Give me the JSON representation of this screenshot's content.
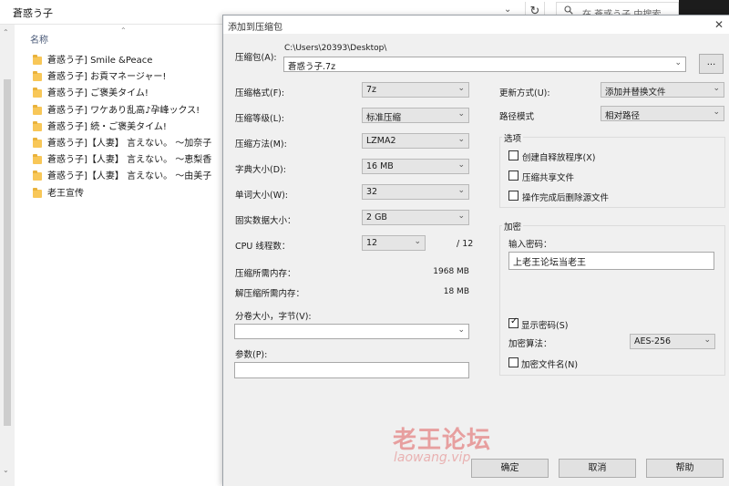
{
  "explorer": {
    "path": "蒼惑う子",
    "search_placeholder": "在 蒼惑う子 中搜索",
    "column_header": "名称",
    "files": [
      "蒼惑う子] Smile &Peace",
      "蒼惑う子] お貢マネージャー!",
      "蒼惑う子] ご褒美タイム!",
      "蒼惑う子] ワケあり乱高♪孕峰ックス!",
      "蒼惑う子] 続・ご褒美タイム!",
      "蒼惑う子]【人妻】 言えない。 ～加奈子",
      "蒼惑う子]【人妻】 言えない。 ～恵梨香",
      "蒼惑う子]【人妻】 言えない。 ～由美子",
      "老王宣传"
    ]
  },
  "dialog": {
    "title": "添加到压缩包",
    "archive_label": "压缩包(A):",
    "archive_dir": "C:\\Users\\20393\\Desktop\\",
    "archive_name": "蒼惑う子.7z",
    "browse_label": "...",
    "format_label": "压缩格式(F):",
    "format_value": "7z",
    "level_label": "压缩等级(L):",
    "level_value": "标准压缩",
    "method_label": "压缩方法(M):",
    "method_value": "LZMA2",
    "dict_label": "字典大小(D):",
    "dict_value": "16 MB",
    "word_label": "单词大小(W):",
    "word_value": "32",
    "solid_label": "固实数据大小：",
    "solid_value": "2 GB",
    "threads_label": "CPU 线程数：",
    "threads_value": "12",
    "threads_total": "/ 12",
    "mem_compress_label": "压缩所需内存：",
    "mem_compress_value": "1968 MB",
    "mem_decompress_label": "解压缩所需内存：",
    "mem_decompress_value": "18 MB",
    "split_label": "分卷大小，字节(V):",
    "split_value": "",
    "params_label": "参数(P):",
    "params_value": "",
    "update_label": "更新方式(U):",
    "update_value": "添加并替换文件",
    "path_mode_label": "路径模式",
    "path_mode_value": "相对路径",
    "options_title": "选项",
    "opt_sfx": "创建自释放程序(X)",
    "opt_shared": "压缩共享文件",
    "opt_delete": "操作完成后删除源文件",
    "encryption_title": "加密",
    "password_label": "输入密码：",
    "password_value": "上老王论坛当老王",
    "show_password": "显示密码(S)",
    "enc_method_label": "加密算法：",
    "enc_method_value": "AES-256",
    "encrypt_names": "加密文件名(N)",
    "ok": "确定",
    "cancel": "取消",
    "help": "帮助"
  },
  "watermark": {
    "main": "老王论坛",
    "sub": "laowang.vip"
  }
}
